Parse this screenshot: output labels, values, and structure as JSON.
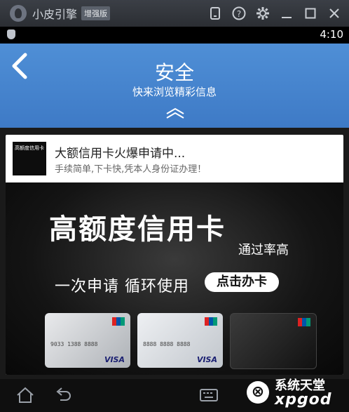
{
  "emulator": {
    "title": "小皮引擎",
    "badge": "增强版",
    "icons": [
      "phone-icon",
      "help-icon",
      "settings-icon",
      "minimize-icon",
      "maximize-icon",
      "close-icon"
    ]
  },
  "status_bar": {
    "time": "4:10"
  },
  "app_bar": {
    "title": "安全",
    "subtitle": "快来浏览精彩信息"
  },
  "ad": {
    "thumb_text": "高额度信用卡",
    "title": "大额信用卡火爆申请中...",
    "description": "手续简单,下卡快,凭本人身份证办理！",
    "banner": {
      "headline": "高额度信用卡",
      "rate": "通过率高",
      "slogan": "一次申请 循环使用",
      "cta": "点击办卡",
      "card_numbers": [
        "9033 1388 8888",
        "8888 8888 8888"
      ],
      "card_brand": "VISA"
    }
  },
  "watermark": {
    "top": "系统天堂",
    "bottom": "xpgod"
  },
  "colors": {
    "app_bar": "#4a88d2",
    "emulator_bar": "#33363c",
    "navbar": "#0f0f0f"
  }
}
